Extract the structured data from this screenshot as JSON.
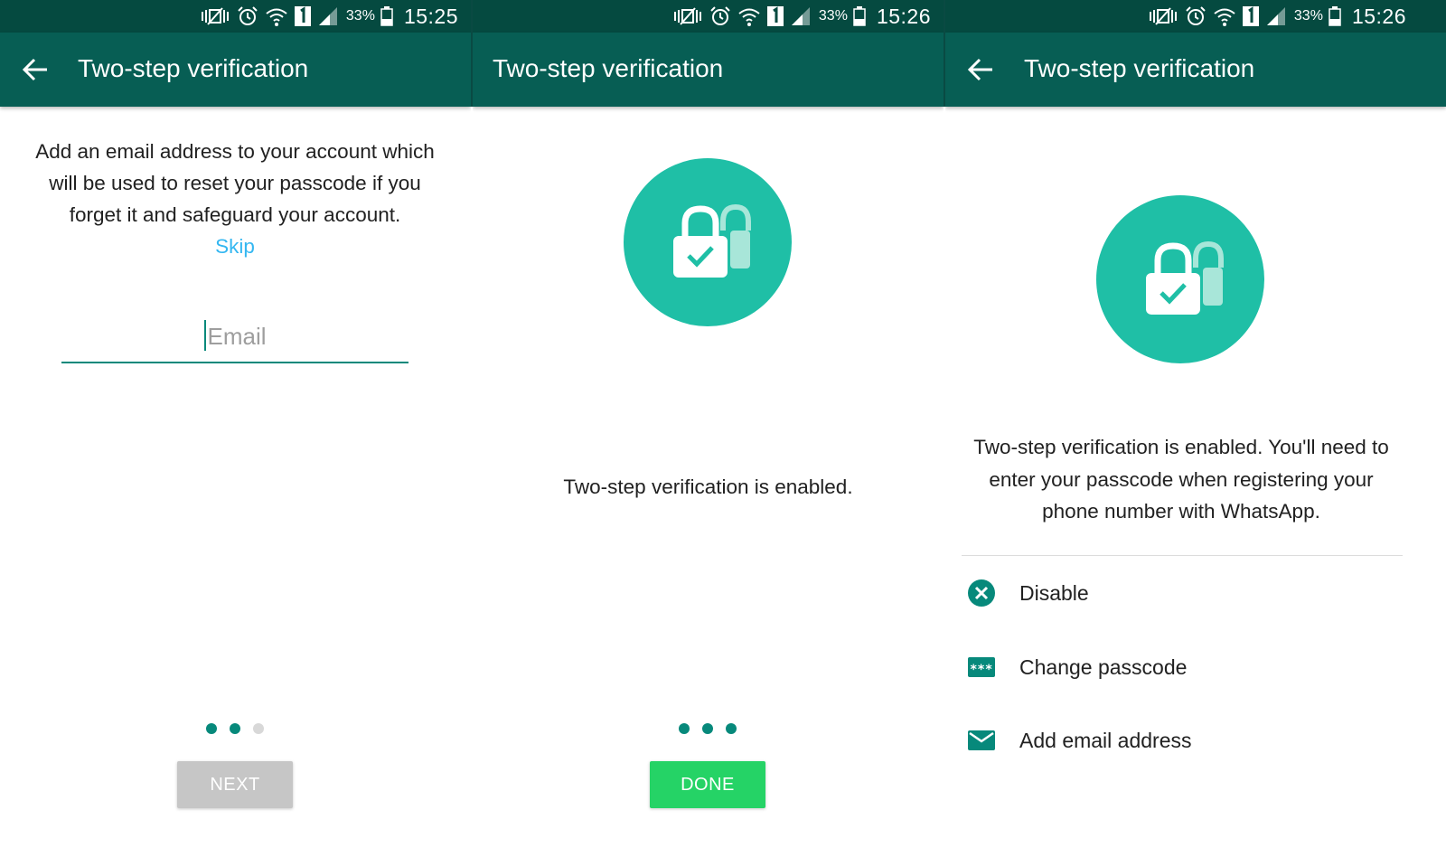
{
  "status_bars": [
    {
      "battery": "33%",
      "time": "15:25"
    },
    {
      "battery": "33%",
      "time": "15:26"
    },
    {
      "battery": "33%",
      "time": "15:26"
    }
  ],
  "screen1": {
    "title": "Two-step verification",
    "description": "Add an email address to your account which will be used to reset your passcode if you forget it and safeguard your account.",
    "skip_label": "Skip",
    "email_placeholder": "Email",
    "email_value": "",
    "button_label": "NEXT",
    "button_enabled": false,
    "page_indicator": {
      "total": 3,
      "active": [
        1,
        2
      ]
    }
  },
  "screen2": {
    "title": "Two-step verification",
    "message": "Two-step verification is enabled.",
    "button_label": "DONE",
    "button_enabled": true,
    "page_indicator": {
      "total": 3,
      "active": [
        1,
        2,
        3
      ]
    }
  },
  "screen3": {
    "title": "Two-step verification",
    "message": "Two-step verification is enabled. You'll need to enter your passcode when registering your phone number with WhatsApp.",
    "options": [
      {
        "label": "Disable",
        "icon": "cancel-circle-icon"
      },
      {
        "label": "Change passcode",
        "icon": "password-dots-icon"
      },
      {
        "label": "Add email address",
        "icon": "email-envelope-icon"
      }
    ]
  },
  "colors": {
    "status_bar": "#054a40",
    "app_bar": "#075e54",
    "accent_teal": "#1fbfa6",
    "icon_teal": "#07897b",
    "link_blue": "#34b7f1",
    "done_green": "#25d366",
    "disabled_gray": "#c6c6c6",
    "dot_inactive": "#d8d8d8"
  }
}
